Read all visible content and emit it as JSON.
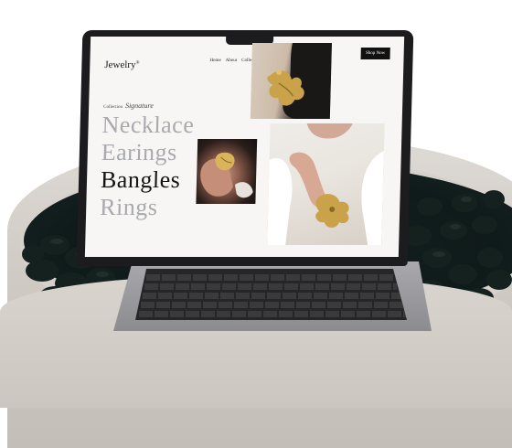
{
  "site": {
    "logo": "Jewelry",
    "logo_mark": "®",
    "nav": [
      "Home",
      "About",
      "Collection",
      "Blog"
    ],
    "cta": "Shop Now"
  },
  "hero": {
    "kicker": "Collection",
    "kicker_script": "Signature",
    "categories": [
      {
        "label": "Necklace",
        "active": false
      },
      {
        "label": "Earings",
        "active": false
      },
      {
        "label": "Bangles",
        "active": true
      },
      {
        "label": "Rings",
        "active": false
      }
    ]
  },
  "colors": {
    "active_text": "#141414",
    "inactive_text": "#a9aaae",
    "button_bg": "#111111",
    "gold": "#c9a24a",
    "pebbles": "#14201f"
  },
  "icons": {
    "earring_photo": "gold-flower-earring",
    "ring_photo": "gold-leaf-ring",
    "bangle_photo": "gold-flower-bangle"
  }
}
